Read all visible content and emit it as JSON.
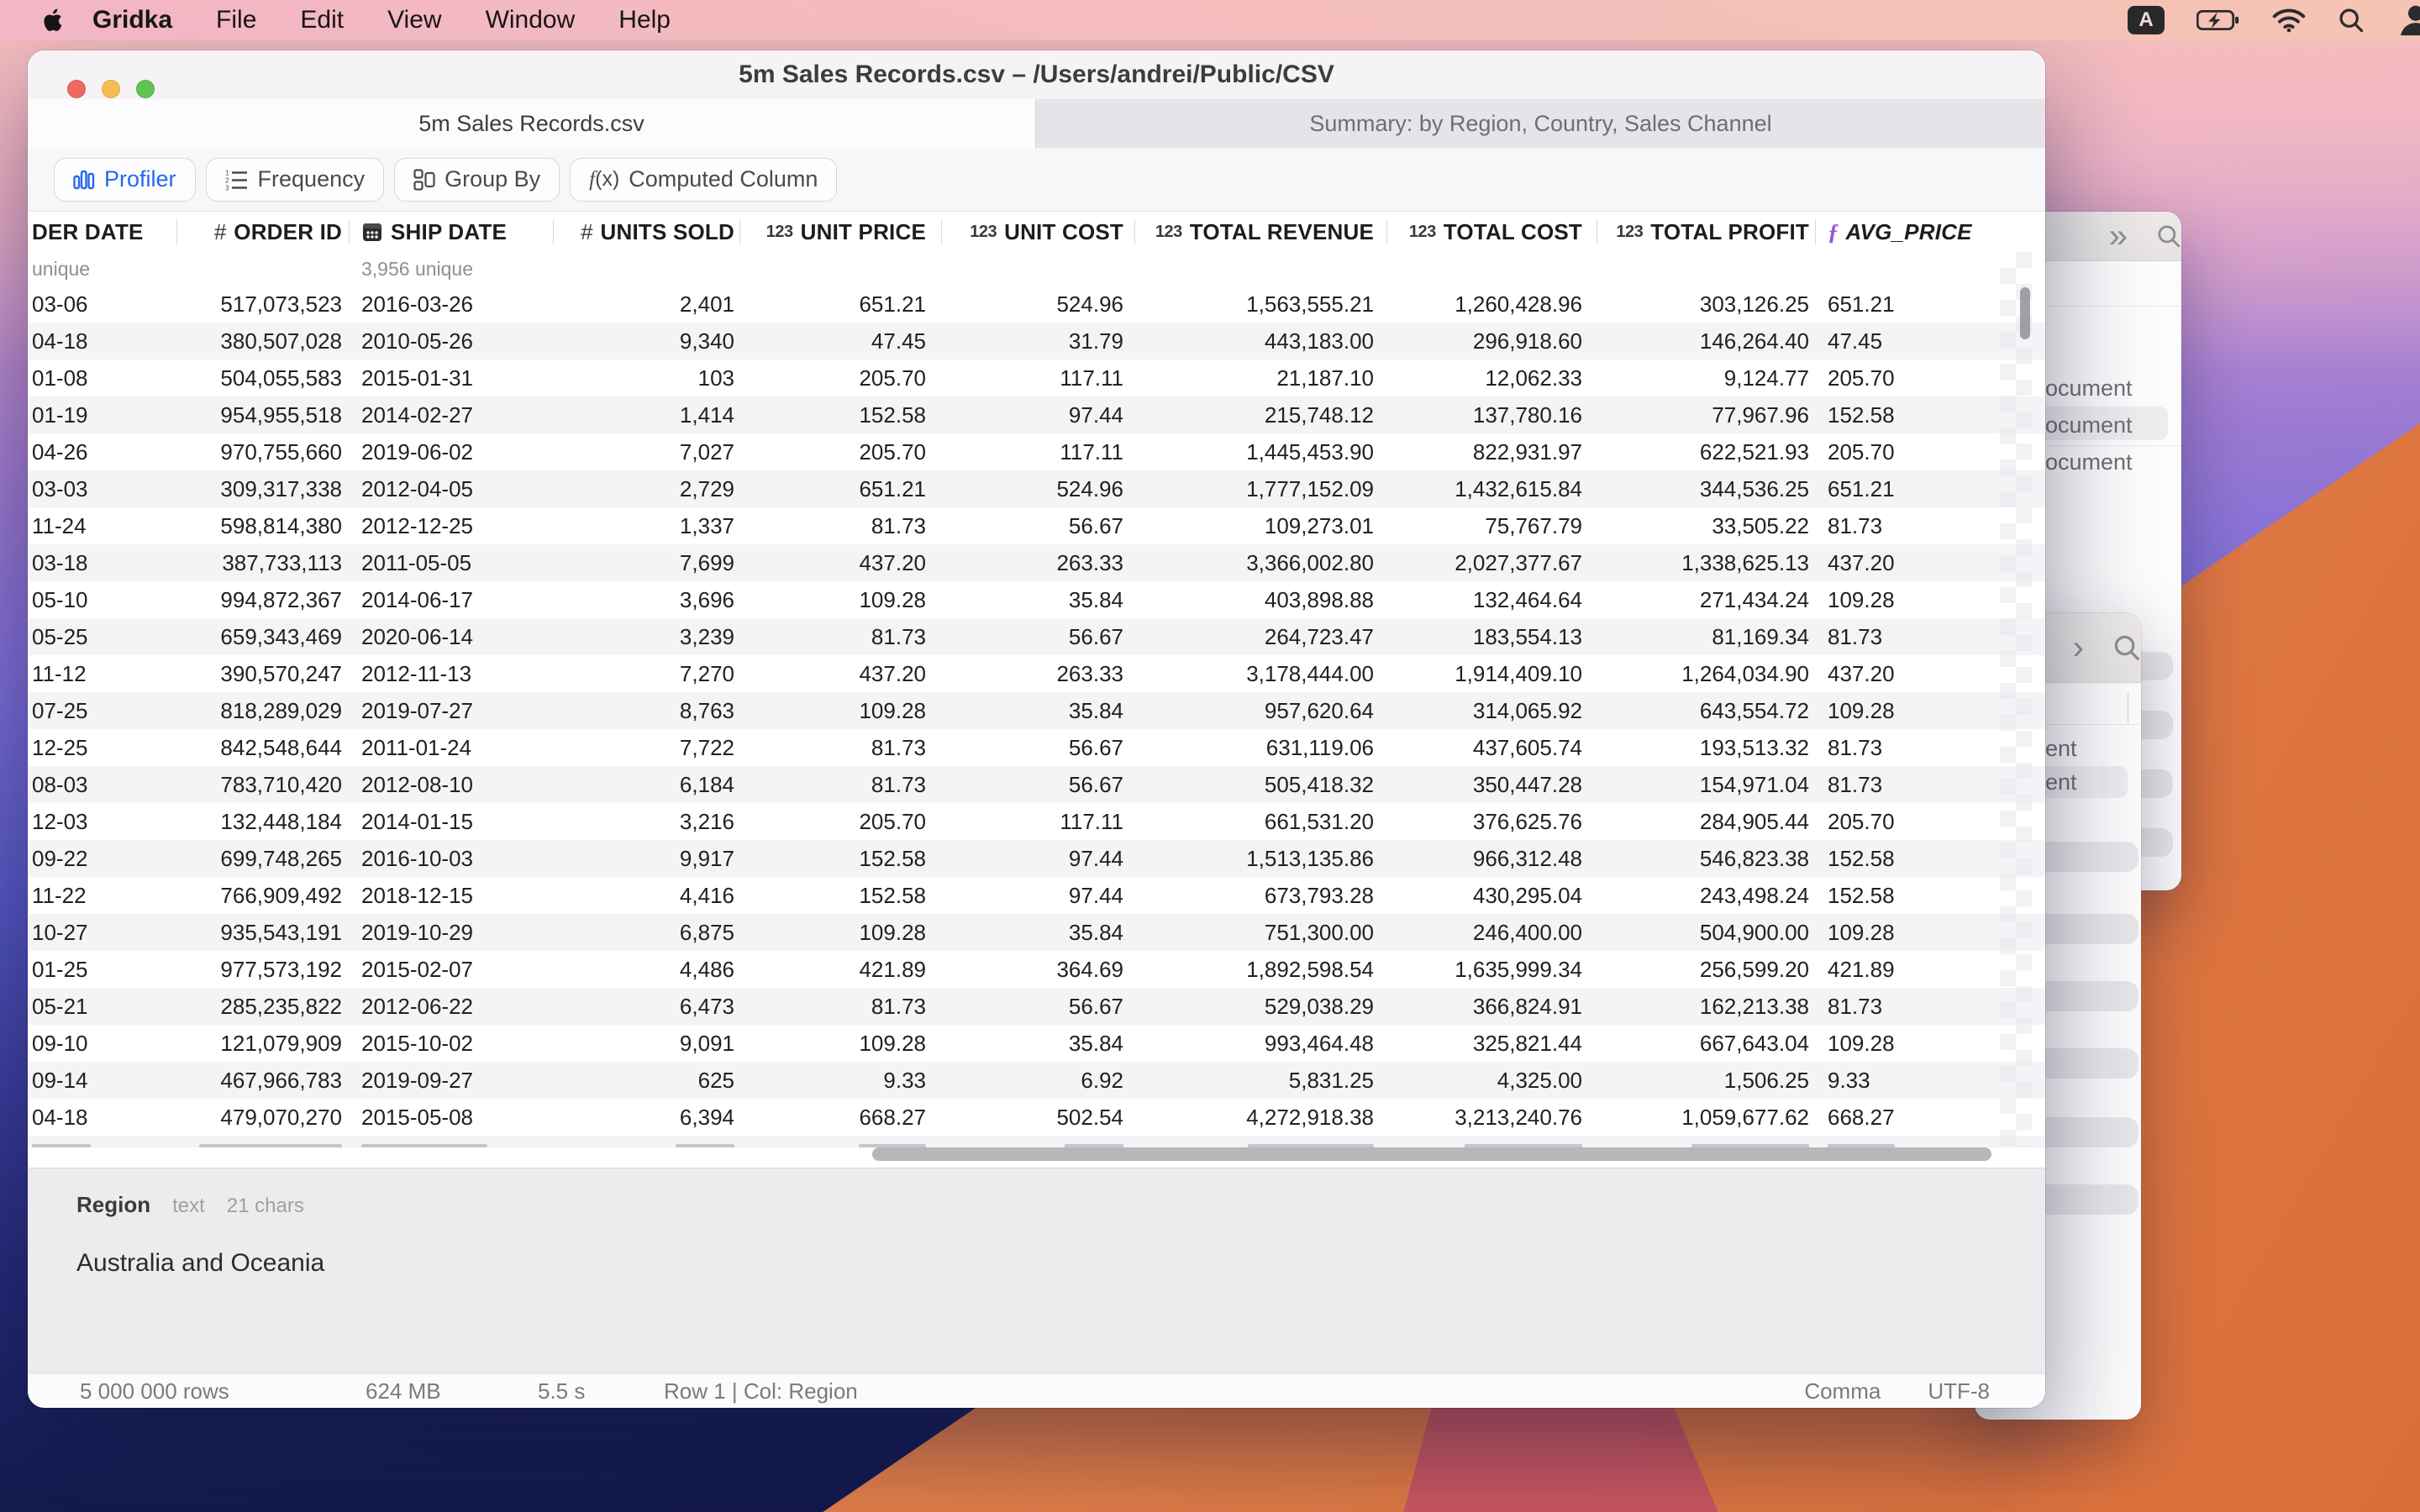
{
  "menu_bar": {
    "app_name": "Gridka",
    "items": [
      "File",
      "Edit",
      "View",
      "Window",
      "Help"
    ],
    "status_icons": [
      "input-source-a",
      "battery-charging",
      "wifi",
      "search",
      "user-switcher"
    ]
  },
  "window": {
    "title": "5m Sales Records.csv – /Users/andrei/Public/CSV",
    "tabs": [
      {
        "label": "5m Sales Records.csv",
        "active": true
      },
      {
        "label": "Summary: by Region, Country, Sales Channel",
        "active": false
      }
    ],
    "toolbar": {
      "buttons": [
        {
          "label": "Profiler",
          "icon": "bar-chart",
          "active": true
        },
        {
          "label": "Frequency",
          "icon": "numbered-list",
          "active": false
        },
        {
          "label": "Group By",
          "icon": "group-by",
          "active": false
        },
        {
          "label": "Computed Column",
          "icon": "fx",
          "active": false
        }
      ]
    },
    "table": {
      "columns": [
        {
          "label": "DER DATE",
          "prefix": "none",
          "align": "left",
          "stat": "unique"
        },
        {
          "label": "ORDER ID",
          "prefix": "hash",
          "align": "right",
          "stat": ""
        },
        {
          "label": "SHIP DATE",
          "prefix": "calendar",
          "align": "left",
          "stat": "3,956 unique"
        },
        {
          "label": "UNITS SOLD",
          "prefix": "hash",
          "align": "right",
          "stat": ""
        },
        {
          "label": "UNIT PRICE",
          "prefix": "123",
          "align": "right",
          "stat": ""
        },
        {
          "label": "UNIT COST",
          "prefix": "123",
          "align": "right",
          "stat": ""
        },
        {
          "label": "TOTAL REVENUE",
          "prefix": "123",
          "align": "right",
          "stat": ""
        },
        {
          "label": "TOTAL COST",
          "prefix": "123",
          "align": "right",
          "stat": ""
        },
        {
          "label": "TOTAL PROFIT",
          "prefix": "123",
          "align": "right",
          "stat": ""
        },
        {
          "label": "AVG_PRICE",
          "prefix": "fx",
          "align": "left",
          "stat": "",
          "italic": true
        }
      ],
      "rows": [
        [
          "03-06",
          "517,073,523",
          "2016-03-26",
          "2,401",
          "651.21",
          "524.96",
          "1,563,555.21",
          "1,260,428.96",
          "303,126.25",
          "651.21"
        ],
        [
          "04-18",
          "380,507,028",
          "2010-05-26",
          "9,340",
          "47.45",
          "31.79",
          "443,183.00",
          "296,918.60",
          "146,264.40",
          "47.45"
        ],
        [
          "01-08",
          "504,055,583",
          "2015-01-31",
          "103",
          "205.70",
          "117.11",
          "21,187.10",
          "12,062.33",
          "9,124.77",
          "205.70"
        ],
        [
          "01-19",
          "954,955,518",
          "2014-02-27",
          "1,414",
          "152.58",
          "97.44",
          "215,748.12",
          "137,780.16",
          "77,967.96",
          "152.58"
        ],
        [
          "04-26",
          "970,755,660",
          "2019-06-02",
          "7,027",
          "205.70",
          "117.11",
          "1,445,453.90",
          "822,931.97",
          "622,521.93",
          "205.70"
        ],
        [
          "03-03",
          "309,317,338",
          "2012-04-05",
          "2,729",
          "651.21",
          "524.96",
          "1,777,152.09",
          "1,432,615.84",
          "344,536.25",
          "651.21"
        ],
        [
          "11-24",
          "598,814,380",
          "2012-12-25",
          "1,337",
          "81.73",
          "56.67",
          "109,273.01",
          "75,767.79",
          "33,505.22",
          "81.73"
        ],
        [
          "03-18",
          "387,733,113",
          "2011-05-05",
          "7,699",
          "437.20",
          "263.33",
          "3,366,002.80",
          "2,027,377.67",
          "1,338,625.13",
          "437.20"
        ],
        [
          "05-10",
          "994,872,367",
          "2014-06-17",
          "3,696",
          "109.28",
          "35.84",
          "403,898.88",
          "132,464.64",
          "271,434.24",
          "109.28"
        ],
        [
          "05-25",
          "659,343,469",
          "2020-06-14",
          "3,239",
          "81.73",
          "56.67",
          "264,723.47",
          "183,554.13",
          "81,169.34",
          "81.73"
        ],
        [
          "11-12",
          "390,570,247",
          "2012-11-13",
          "7,270",
          "437.20",
          "263.33",
          "3,178,444.00",
          "1,914,409.10",
          "1,264,034.90",
          "437.20"
        ],
        [
          "07-25",
          "818,289,029",
          "2019-07-27",
          "8,763",
          "109.28",
          "35.84",
          "957,620.64",
          "314,065.92",
          "643,554.72",
          "109.28"
        ],
        [
          "12-25",
          "842,548,644",
          "2011-01-24",
          "7,722",
          "81.73",
          "56.67",
          "631,119.06",
          "437,605.74",
          "193,513.32",
          "81.73"
        ],
        [
          "08-03",
          "783,710,420",
          "2012-08-10",
          "6,184",
          "81.73",
          "56.67",
          "505,418.32",
          "350,447.28",
          "154,971.04",
          "81.73"
        ],
        [
          "12-03",
          "132,448,184",
          "2014-01-15",
          "3,216",
          "205.70",
          "117.11",
          "661,531.20",
          "376,625.76",
          "284,905.44",
          "205.70"
        ],
        [
          "09-22",
          "699,748,265",
          "2016-10-03",
          "9,917",
          "152.58",
          "97.44",
          "1,513,135.86",
          "966,312.48",
          "546,823.38",
          "152.58"
        ],
        [
          "11-22",
          "766,909,492",
          "2018-12-15",
          "4,416",
          "152.58",
          "97.44",
          "673,793.28",
          "430,295.04",
          "243,498.24",
          "152.58"
        ],
        [
          "10-27",
          "935,543,191",
          "2019-10-29",
          "6,875",
          "109.28",
          "35.84",
          "751,300.00",
          "246,400.00",
          "504,900.00",
          "109.28"
        ],
        [
          "01-25",
          "977,573,192",
          "2015-02-07",
          "4,486",
          "421.89",
          "364.69",
          "1,892,598.54",
          "1,635,999.34",
          "256,599.20",
          "421.89"
        ],
        [
          "05-21",
          "285,235,822",
          "2012-06-22",
          "6,473",
          "81.73",
          "56.67",
          "529,038.29",
          "366,824.91",
          "162,213.38",
          "81.73"
        ],
        [
          "09-10",
          "121,079,909",
          "2015-10-02",
          "9,091",
          "109.28",
          "35.84",
          "993,464.48",
          "325,821.44",
          "667,643.04",
          "109.28"
        ],
        [
          "09-14",
          "467,966,783",
          "2019-09-27",
          "625",
          "9.33",
          "6.92",
          "5,831.25",
          "4,325.00",
          "1,506.25",
          "9.33"
        ],
        [
          "04-18",
          "479,070,270",
          "2015-05-08",
          "6,394",
          "668.27",
          "502.54",
          "4,272,918.38",
          "3,213,240.76",
          "1,059,677.62",
          "668.27"
        ]
      ]
    },
    "detail_panel": {
      "column_name": "Region",
      "column_type": "text",
      "column_length": "21 chars",
      "cell_value": "Australia and Oceania"
    },
    "status_bar": {
      "rows": "5 000 000 rows",
      "size": "624 MB",
      "time": "5.5 s",
      "position": "Row 1 | Col: Region",
      "delimiter": "Comma",
      "encoding": "UTF-8"
    }
  },
  "background_windows": {
    "rear": {
      "items": [
        "ocument",
        "ocument",
        "ocument"
      ]
    },
    "front": {
      "items": [
        "ent",
        "ent"
      ]
    }
  },
  "colors": {
    "accent_blue": "#2667f0",
    "fx_purple": "#9b51e0",
    "window_chrome": "#f5f3f6",
    "row_alt": "#f4f4f6"
  }
}
